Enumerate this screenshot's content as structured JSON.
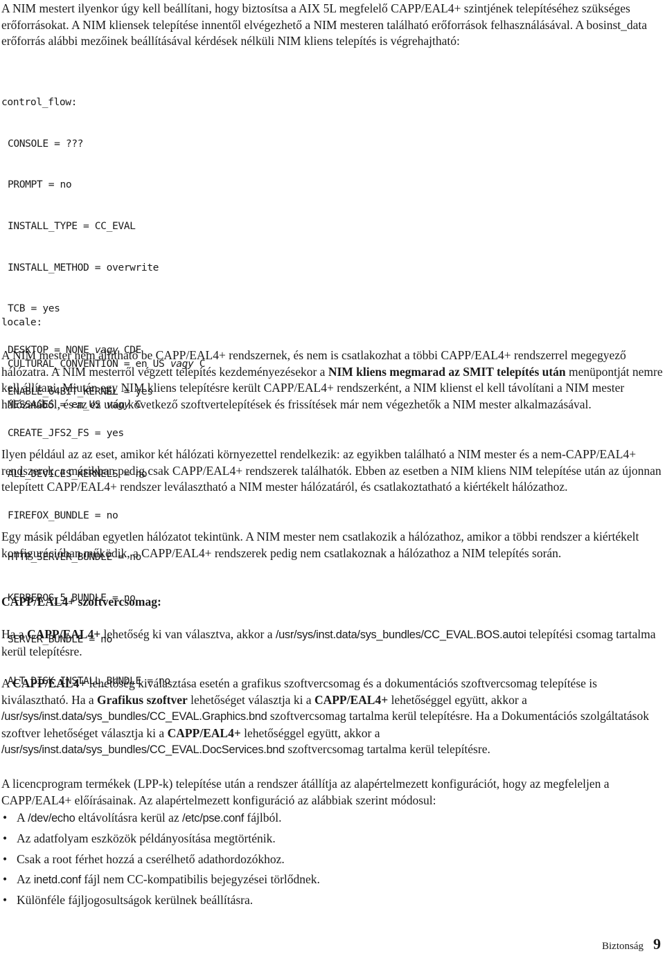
{
  "intro": {
    "text": "A NIM mestert ilyenkor úgy kell beállítani, hogy biztosítsa a AIX 5L megfelelő CAPP/EAL4+ szintjének telepítéséhez szükséges erőforrásokat. A NIM kliensek telepítése innentől elvégezhető a NIM mesteren található erőforrások felhasználásával. A bosinst_data erőforrás alábbi mezőinek beállításával kérdések nélküli NIM kliens telepítés is végrehajtható:"
  },
  "code": {
    "control_flow_header": "control_flow:",
    "control_flow_lines": [
      {
        "text": "CONSOLE = ???"
      },
      {
        "text": "PROMPT = no"
      },
      {
        "text": "INSTALL_TYPE = CC_EVAL"
      },
      {
        "text": "INSTALL_METHOD = overwrite"
      },
      {
        "text": "TCB = yes"
      },
      {
        "pre": "DESKTOP = NONE ",
        "ital": "vagy",
        "post": " CDE"
      },
      {
        "text": "ENABLE_64BIT_KERNEL = yes"
      },
      {
        "text": "CREATE_JFS2_FS = yes"
      },
      {
        "text": "ALL_DEVICES_KERNELS = no"
      },
      {
        "text": "FIREFOX_BUNDLE = no"
      },
      {
        "text": "HTTP_SERVER_BUNDLE = no"
      },
      {
        "text": "KERBEROS_5_BUNDLE = no"
      },
      {
        "text": "SERVER_BUNDLE = no"
      },
      {
        "text": "ALT_DISK_INSTALL_BUNDLE = no"
      }
    ],
    "locale_header": "locale:",
    "locale_lines": [
      {
        "pre": "CULTURAL_CONVENTION = en_US ",
        "ital": "vagy",
        "post": " C"
      },
      {
        "pre": "MESSAGES = en_US ",
        "ital": "vagy",
        "post": " C"
      }
    ]
  },
  "para_nim_master": {
    "t1": "A NIM mester nem állítható be CAPP/EAL4+ rendszernek, és nem is csatlakozhat a többi CAPP/EAL4+ rendszerrel megegyező hálózatra. A NIM mesterről végzett telepítés kezdeményezésekor a ",
    "b1": "NIM kliens megmarad az SMIT telepítés után",
    "t2": " menüpontját nemre kell állítani. Miután egy NIM kliens telepítésre került CAPP/EAL4+ rendszerként, a NIM klienst el kell távolítani a NIM mester hálózatából, és az ez után következő szoftvertelepítések és frissítések már nem végezhetők a NIM mester alkalmazásával."
  },
  "para_example1": {
    "text": "Ilyen például az az eset, amikor két hálózati környezettel rendelkezik: az egyikben található a NIM mester és a nem-CAPP/EAL4+ rendszerek, a másikban pedig csak CAPP/EAL4+ rendszerek találhatók. Ebben az esetben a NIM kliens NIM telepítése után az újonnan telepített CAPP/EAL4+ rendszer leválasztható a NIM mester hálózatáról, és csatlakoztatható a kiértékelt hálózathoz."
  },
  "para_example2": {
    "text": "Egy másik példában egyetlen hálózatot tekintünk. A NIM mester nem csatlakozik a hálózathoz, amikor a többi rendszer a kiértékelt konfigurációban működik, a CAPP/EAL4+ rendszerek pedig nem csatlakoznak a hálózathoz a NIM telepítés során."
  },
  "section_heading": "CAPP/EAL4+ szoftvercsomag:",
  "para_bos": {
    "t1": "Ha a ",
    "b1": "CAPP/EAL4+",
    "t2": " lehetőség ki van választva, akkor a ",
    "path": "/usr/sys/inst.data/sys_bundles/CC_EVAL.BOS.autoi",
    "t3": " telepítési csomag tartalma kerül telepítésre."
  },
  "para_graphics": {
    "t1": "A ",
    "b1": "CAPP/EAL4+",
    "t2": " lehetőség kiválasztása esetén a grafikus szoftvercsomag és a dokumentációs szoftvercsomag telepítése is kiválasztható. Ha a ",
    "b2": "Grafikus szoftver",
    "t3": " lehetőséget választja ki a ",
    "b3": "CAPP/EAL4+",
    "t4": " lehetőséggel együtt, akkor a ",
    "path1": "/usr/sys/inst.data/sys_bundles/CC_EVAL.Graphics.bnd",
    "t5": " szoftvercsomag tartalma kerül telepítésre. Ha a Dokumentációs szolgáltatások szoftver lehetőséget választja ki a ",
    "b4": "CAPP/EAL4+",
    "t6": " lehetőséggel együtt, akkor a ",
    "path2": "/usr/sys/inst.data/sys_bundles/CC_EVAL.DocServices.bnd",
    "t7": " szoftvercsomag tartalma kerül telepítésre."
  },
  "para_lpp": {
    "text": "A licencprogram termékek (LPP-k) telepítése után a rendszer átállítja az alapértelmezett konfigurációt, hogy az megfeleljen a CAPP/EAL4+ előírásainak. Az alapértelmezett konfiguráció az alábbiak szerint módosul:"
  },
  "bullets": {
    "glyph": "•",
    "b0": {
      "t1": "A ",
      "s1": "/dev/echo",
      "t2": " eltávolításra kerül az ",
      "s2": "/etc/pse.conf",
      "t3": " fájlból."
    },
    "b1": {
      "text": "Az adatfolyam eszközök példányosítása megtörténik."
    },
    "b2": {
      "text": "Csak a root férhet hozzá a cserélhető adathordozókhoz."
    },
    "b3": {
      "t1": "Az ",
      "s1": "inetd.conf",
      "t2": " fájl nem CC-kompatibilis bejegyzései törlődnek."
    },
    "b4": {
      "text": "Különféle fájljogosultságok kerülnek beállításra."
    }
  },
  "footer": {
    "section": "Biztonság",
    "page_number": "9"
  }
}
